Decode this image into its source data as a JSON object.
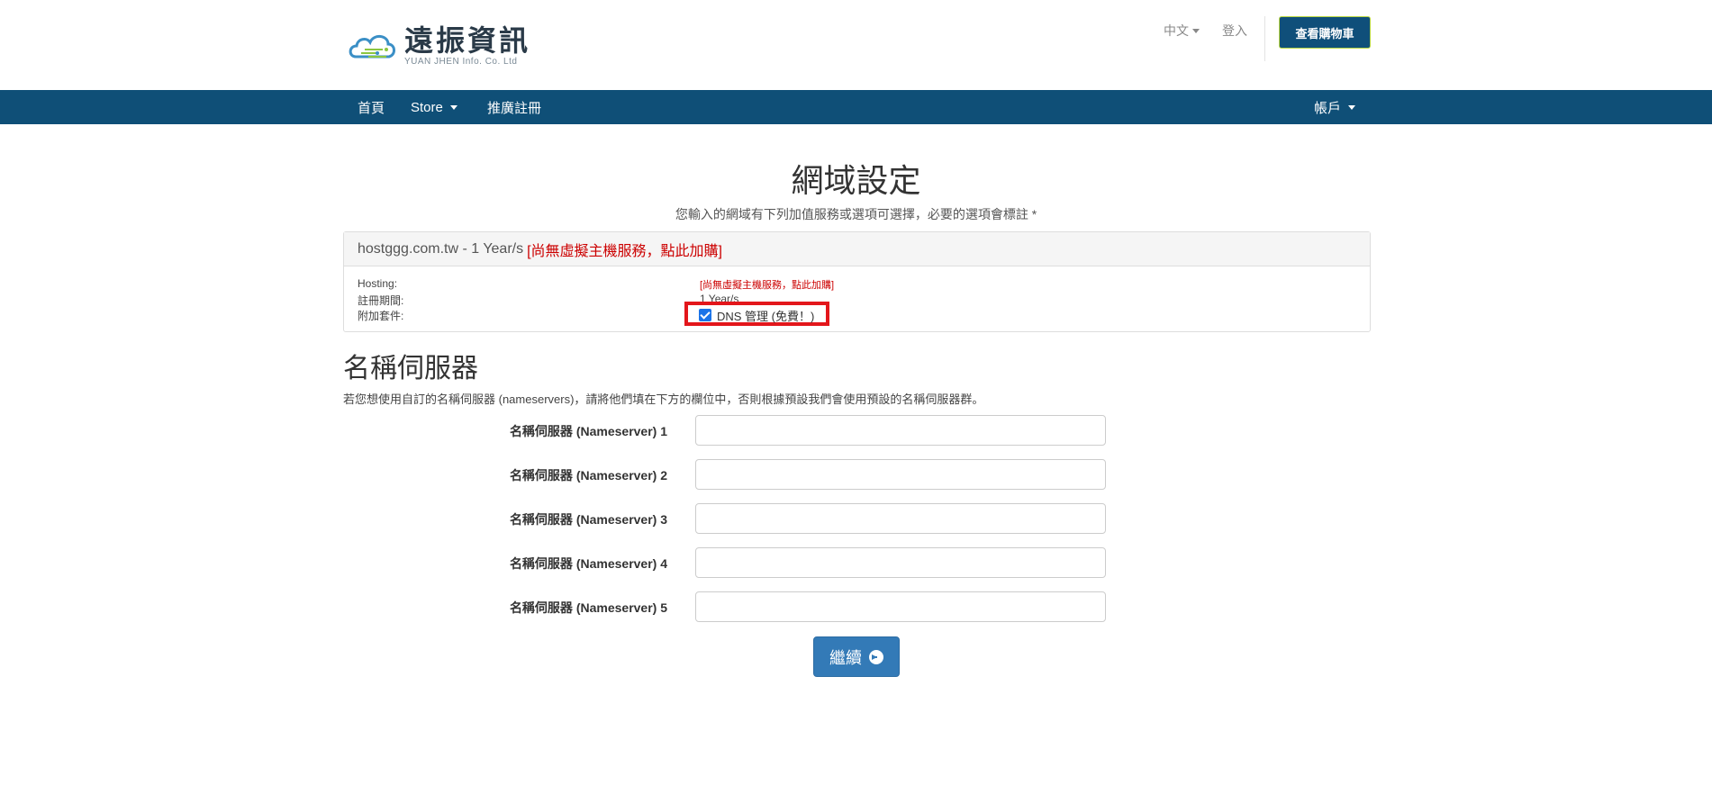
{
  "header": {
    "logo_cn": "遠振資訊",
    "logo_en": "YUAN JHEN Info. Co. Ltd",
    "language": "中文",
    "login": "登入",
    "cart_button": "查看購物車"
  },
  "nav": {
    "items": [
      {
        "label": "首頁"
      },
      {
        "label": "Store"
      },
      {
        "label": "推廣註冊"
      }
    ],
    "account": "帳戶"
  },
  "main": {
    "title": "網域設定",
    "subtitle": "您輸入的網域有下列加值服務或選項可選擇，必要的選項會標註 *",
    "domain_panel": {
      "domain": "hostggg.com.tw - 1 Year/s",
      "no_hosting_link": "[尚無虛擬主機服務，點此加購]",
      "rows": [
        {
          "label": "Hosting:",
          "value": "[尚無虛擬主機服務，點此加購]"
        },
        {
          "label": "註冊期間:",
          "value": "1 Year/s"
        },
        {
          "label": "附加套件:",
          "value": "DNS 管理 (免費！)"
        }
      ],
      "dns_checked": true
    },
    "nameservers": {
      "title": "名稱伺服器",
      "description": "若您想使用自訂的名稱伺服器 (nameservers)，請將他們填在下方的欄位中，否則根據預設我們會使用預設的名稱伺服器群。",
      "fields": [
        {
          "label": "名稱伺服器 (Nameserver) 1",
          "value": ""
        },
        {
          "label": "名稱伺服器 (Nameserver) 2",
          "value": ""
        },
        {
          "label": "名稱伺服器 (Nameserver) 3",
          "value": ""
        },
        {
          "label": "名稱伺服器 (Nameserver) 4",
          "value": ""
        },
        {
          "label": "名稱伺服器 (Nameserver) 5",
          "value": ""
        }
      ]
    },
    "continue_button": "繼續"
  },
  "colors": {
    "nav_bg": "#0f4f77",
    "button_primary": "#337ab7",
    "highlight_red": "#e3161b",
    "warning_red": "#cc0000"
  }
}
